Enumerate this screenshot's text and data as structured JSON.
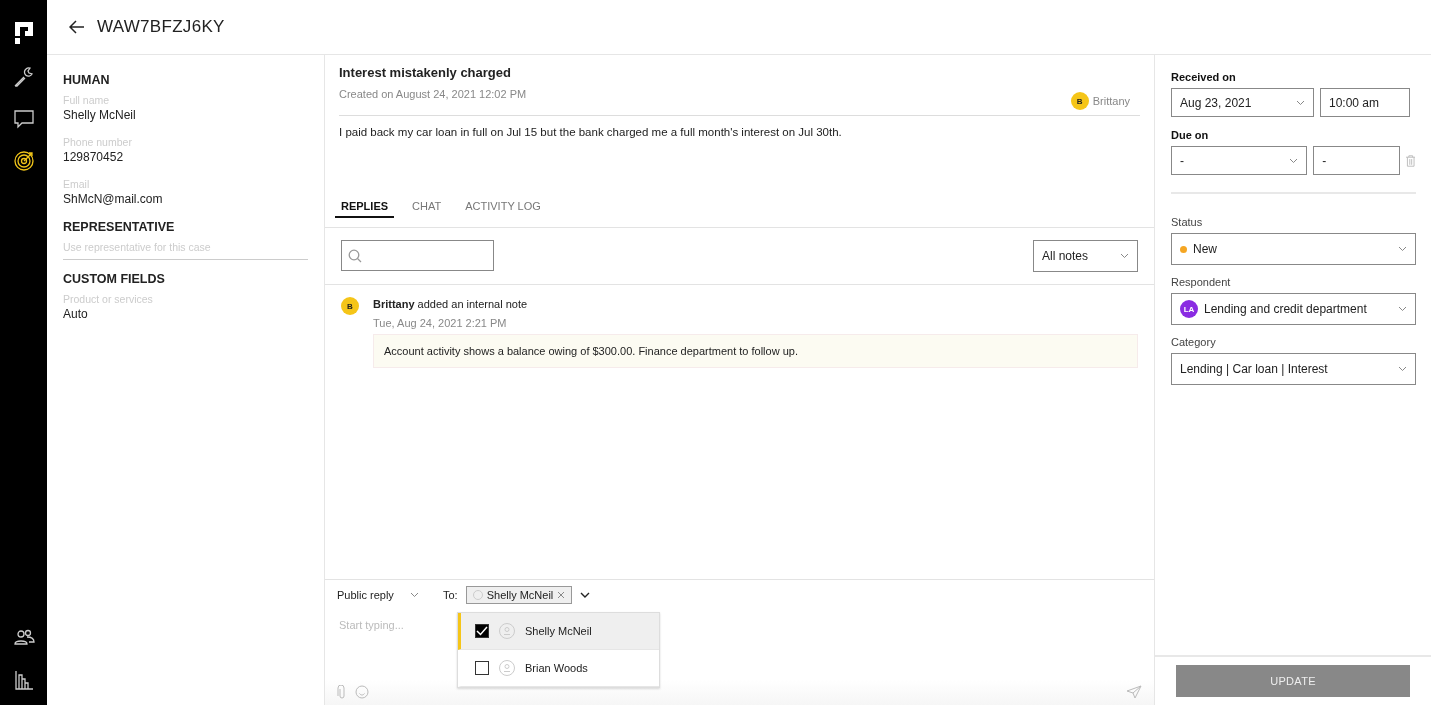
{
  "nav": [
    {
      "kind": "wrench",
      "selected": false
    },
    {
      "kind": "chat",
      "selected": false
    },
    {
      "kind": "target",
      "selected": true
    },
    {
      "kind": "people",
      "selected": false
    },
    {
      "kind": "chart",
      "selected": false
    }
  ],
  "header": {
    "title": "WAW7BFZJ6KY"
  },
  "human": {
    "heading": "HUMAN",
    "fields": [
      {
        "label": "Full name",
        "value": "Shelly McNeil"
      },
      {
        "label": "Phone number",
        "value": "129870452"
      },
      {
        "label": "Email",
        "value": "ShMcN@mail.com"
      }
    ]
  },
  "representative": {
    "heading": "REPRESENTATIVE",
    "placeholder": "Use representative for this case"
  },
  "custom_fields": {
    "heading": "CUSTOM FIELDS",
    "fields": [
      {
        "label": "Product or services",
        "value": "Auto"
      }
    ]
  },
  "case": {
    "title": "Interest mistakenly charged",
    "created": "Created on August 24, 2021 12:02 PM",
    "assignee": {
      "initial": "B",
      "name": "Brittany"
    },
    "description": "I paid back my car loan in full on Jul 15 but the bank charged me a full month's interest on Jul 30th."
  },
  "tabs": [
    {
      "label": "REPLIES",
      "selected": true
    },
    {
      "label": "CHAT",
      "selected": false
    },
    {
      "label": "ACTIVITY LOG",
      "selected": false
    }
  ],
  "notes_filter": "All notes",
  "notes": [
    {
      "initial": "B",
      "headline": "**Brittany** added an internal note",
      "time": "Tue, Aug 24, 2021 2:21 PM",
      "body": "Account activity shows a balance owing of $300.00. Finance department to follow up."
    }
  ],
  "composer": {
    "mode": "Public reply",
    "to_label": "To:",
    "recipient": "Shelly McNeil",
    "placeholder": "Start typing...",
    "options": [
      {
        "name": "Shelly McNeil",
        "checked": true,
        "selected": true
      },
      {
        "name": "Brian Woods",
        "checked": false,
        "selected": false
      }
    ]
  },
  "details": {
    "received_label": "Received on",
    "received_date": "Aug 23, 2021",
    "received_time": "10:00 am",
    "due_label": "Due on",
    "due_date": "-",
    "due_time": "-",
    "status_label": "Status",
    "status": {
      "value": "New",
      "color": "#f5a623"
    },
    "respondent_label": "Respondent",
    "respondent": {
      "initials": "LA",
      "name": "Lending and credit department"
    },
    "category_label": "Category",
    "category": "Lending | Car loan | Interest"
  },
  "update_button": "UPDATE"
}
